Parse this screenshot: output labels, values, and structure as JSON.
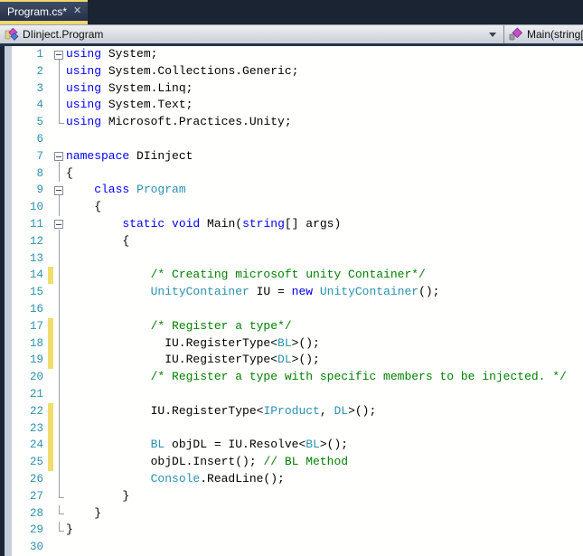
{
  "tab": {
    "title": "Program.cs*",
    "close_icon": "✕"
  },
  "navbar": {
    "type_combo": {
      "label": "DIinject.Program",
      "icon": "class-icon"
    },
    "member_combo": {
      "label": "Main(string[]",
      "icon": "method-icon"
    }
  },
  "colors": {
    "accent_yellow": "#eed76b",
    "change_bar": "#f0dd6d",
    "tab_bar_bg": "#1a2433",
    "keyword": "#0000ff",
    "type": "#2b91af",
    "comment": "#008000",
    "plain": "#000000",
    "line_number": "#2b91af",
    "editor_bg": "#fffffe"
  },
  "editor": {
    "lines": [
      {
        "n": 1,
        "fold": "box",
        "chg": false,
        "ind": 0,
        "seg": [
          [
            "kw",
            "using"
          ],
          [
            "pln",
            " System;"
          ]
        ]
      },
      {
        "n": 2,
        "fold": "line",
        "chg": false,
        "ind": 0,
        "seg": [
          [
            "kw",
            "using"
          ],
          [
            "pln",
            " System.Collections.Generic;"
          ]
        ]
      },
      {
        "n": 3,
        "fold": "line",
        "chg": false,
        "ind": 0,
        "seg": [
          [
            "kw",
            "using"
          ],
          [
            "pln",
            " System.Linq;"
          ]
        ]
      },
      {
        "n": 4,
        "fold": "line",
        "chg": false,
        "ind": 0,
        "seg": [
          [
            "kw",
            "using"
          ],
          [
            "pln",
            " System.Text;"
          ]
        ]
      },
      {
        "n": 5,
        "fold": "end",
        "chg": false,
        "ind": 0,
        "seg": [
          [
            "kw",
            "using"
          ],
          [
            "pln",
            " Microsoft.Practices.Unity;"
          ]
        ]
      },
      {
        "n": 6,
        "fold": "",
        "chg": false,
        "ind": 0,
        "seg": []
      },
      {
        "n": 7,
        "fold": "box",
        "chg": false,
        "ind": 0,
        "seg": [
          [
            "kw",
            "namespace"
          ],
          [
            "pln",
            " DIinject"
          ]
        ]
      },
      {
        "n": 8,
        "fold": "line",
        "chg": false,
        "ind": 0,
        "seg": [
          [
            "pln",
            "{"
          ]
        ]
      },
      {
        "n": 9,
        "fold": "box",
        "chg": false,
        "ind": 4,
        "seg": [
          [
            "kw",
            "class"
          ],
          [
            "pln",
            " "
          ],
          [
            "type",
            "Program"
          ]
        ]
      },
      {
        "n": 10,
        "fold": "line",
        "chg": false,
        "ind": 4,
        "seg": [
          [
            "pln",
            "{"
          ]
        ]
      },
      {
        "n": 11,
        "fold": "box",
        "chg": false,
        "ind": 8,
        "seg": [
          [
            "kw",
            "static"
          ],
          [
            "pln",
            " "
          ],
          [
            "kw",
            "void"
          ],
          [
            "pln",
            " Main("
          ],
          [
            "kw",
            "string"
          ],
          [
            "pln",
            "[] args)"
          ]
        ]
      },
      {
        "n": 12,
        "fold": "line",
        "chg": false,
        "ind": 8,
        "seg": [
          [
            "pln",
            "{"
          ]
        ]
      },
      {
        "n": 13,
        "fold": "line",
        "chg": false,
        "ind": 0,
        "seg": []
      },
      {
        "n": 14,
        "fold": "line",
        "chg": true,
        "ind": 12,
        "seg": [
          [
            "cmt",
            "/* Creating microsoft unity Container*/"
          ]
        ]
      },
      {
        "n": 15,
        "fold": "line",
        "chg": false,
        "ind": 12,
        "seg": [
          [
            "type",
            "UnityContainer"
          ],
          [
            "pln",
            " IU = "
          ],
          [
            "kw",
            "new"
          ],
          [
            "pln",
            " "
          ],
          [
            "type",
            "UnityContainer"
          ],
          [
            "pln",
            "();"
          ]
        ]
      },
      {
        "n": 16,
        "fold": "line",
        "chg": false,
        "ind": 0,
        "seg": []
      },
      {
        "n": 17,
        "fold": "line",
        "chg": true,
        "ind": 12,
        "seg": [
          [
            "cmt",
            "/* Register a type*/"
          ]
        ]
      },
      {
        "n": 18,
        "fold": "line",
        "chg": true,
        "ind": 14,
        "seg": [
          [
            "pln",
            "IU.RegisterType<"
          ],
          [
            "type",
            "BL"
          ],
          [
            "pln",
            ">();"
          ]
        ]
      },
      {
        "n": 19,
        "fold": "line",
        "chg": true,
        "ind": 14,
        "seg": [
          [
            "pln",
            "IU.RegisterType<"
          ],
          [
            "type",
            "DL"
          ],
          [
            "pln",
            ">();"
          ]
        ]
      },
      {
        "n": 20,
        "fold": "line",
        "chg": false,
        "ind": 12,
        "seg": [
          [
            "cmt",
            "/* Register a type with specific members to be injected. */"
          ]
        ]
      },
      {
        "n": 21,
        "fold": "line",
        "chg": false,
        "ind": 0,
        "seg": []
      },
      {
        "n": 22,
        "fold": "line",
        "chg": true,
        "ind": 12,
        "seg": [
          [
            "pln",
            "IU.RegisterType<"
          ],
          [
            "type",
            "IProduct"
          ],
          [
            "pln",
            ", "
          ],
          [
            "type",
            "DL"
          ],
          [
            "pln",
            ">();"
          ]
        ]
      },
      {
        "n": 23,
        "fold": "line",
        "chg": true,
        "ind": 0,
        "seg": []
      },
      {
        "n": 24,
        "fold": "line",
        "chg": true,
        "ind": 12,
        "seg": [
          [
            "type",
            "BL"
          ],
          [
            "pln",
            " objDL = IU.Resolve<"
          ],
          [
            "type",
            "BL"
          ],
          [
            "pln",
            ">();"
          ]
        ]
      },
      {
        "n": 25,
        "fold": "line",
        "chg": true,
        "ind": 12,
        "seg": [
          [
            "pln",
            "objDL.Insert(); "
          ],
          [
            "cmt",
            "// BL Method"
          ]
        ]
      },
      {
        "n": 26,
        "fold": "line",
        "chg": false,
        "ind": 12,
        "seg": [
          [
            "type",
            "Console"
          ],
          [
            "pln",
            ".ReadLine();"
          ]
        ]
      },
      {
        "n": 27,
        "fold": "end",
        "chg": false,
        "ind": 8,
        "seg": [
          [
            "pln",
            "}"
          ]
        ]
      },
      {
        "n": 28,
        "fold": "end",
        "chg": false,
        "ind": 4,
        "seg": [
          [
            "pln",
            "}"
          ]
        ]
      },
      {
        "n": 29,
        "fold": "end",
        "chg": false,
        "ind": 0,
        "seg": [
          [
            "pln",
            "}"
          ]
        ]
      },
      {
        "n": 30,
        "fold": "",
        "chg": false,
        "ind": 0,
        "seg": []
      }
    ]
  }
}
